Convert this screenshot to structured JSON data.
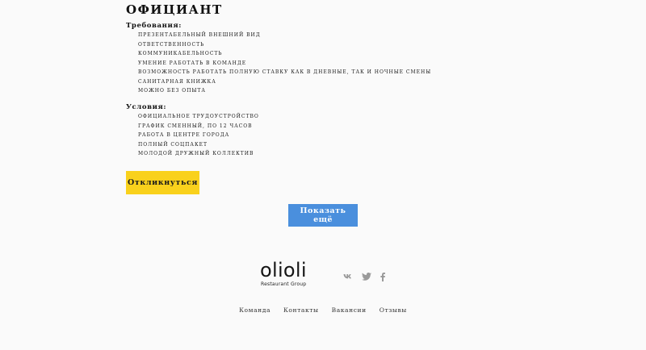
{
  "vacancy": {
    "title": "ОФИЦИАНТ",
    "requirements_label": "Требования:",
    "requirements": [
      "презентабельный внешний вид",
      "ответственность",
      "коммуникабельность",
      "умение работать в команде",
      "возможность работать полную ставку как в дневные, так и ночные смены",
      "санитарная книжка",
      "можно без опыта"
    ],
    "conditions_label": "Условия:",
    "conditions": [
      "официальное трудоустройство",
      "график сменный, по 12 часов",
      "работа в центре города",
      "полный соцпакет",
      "молодой дружный коллектив"
    ],
    "apply_label": "Откликнуться"
  },
  "show_more_label": "Показать ещё",
  "footer": {
    "logo_word": "olioli",
    "logo_sub": "Restaurant Group",
    "social": [
      "vk-icon",
      "twitter-icon",
      "facebook-icon"
    ],
    "nav": [
      "Команда",
      "Контакты",
      "Вакансии",
      "Отзывы"
    ]
  },
  "colors": {
    "apply_button": "#f9d11c",
    "show_more_button": "#4a8fdd",
    "background": "#fafafa",
    "social_icons": "#9a9a9a"
  }
}
